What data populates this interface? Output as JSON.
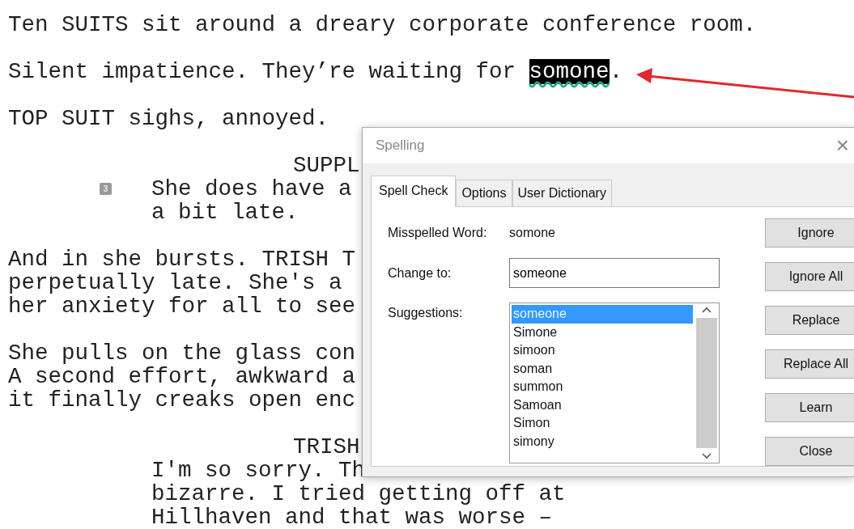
{
  "script": [
    {
      "kind": "action",
      "lines": [
        "Ten SUITS sit around a dreary corporate conference room."
      ]
    },
    {
      "kind": "flagged",
      "before": "Silent impatience. They’re waiting for ",
      "word": "somone",
      "after": "."
    },
    {
      "kind": "action",
      "lines": [
        "TOP SUIT sighs, annoyed."
      ]
    },
    {
      "kind": "character",
      "lines": [
        "SUPPL"
      ]
    },
    {
      "kind": "dialogue",
      "note_number": "3",
      "lines": [
        "She does have a",
        "a bit late."
      ]
    },
    {
      "kind": "action",
      "lines": [
        "And in she bursts. TRISH T",
        "perpetually late. She's a",
        "her anxiety for all to see"
      ]
    },
    {
      "kind": "action",
      "lines": [
        "She pulls on the glass con",
        "A second effort, awkward a",
        "it finally creaks open enc"
      ]
    },
    {
      "kind": "character",
      "lines": [
        "TRISH"
      ]
    },
    {
      "kind": "dialogue",
      "lines": [
        "I'm so sorry. Th",
        "bizarre. I tried getting off at",
        "Hillhaven and that was worse –"
      ]
    }
  ],
  "dialog": {
    "title": "Spelling",
    "close": "×",
    "tabs": [
      {
        "label": "Spell Check",
        "selected": true
      },
      {
        "label": "Options",
        "selected": false
      },
      {
        "label": "User Dictionary",
        "selected": false
      }
    ],
    "misspelled_label": "Misspelled Word:",
    "misspelled_value": "somone",
    "change_label": "Change to:",
    "change_value": "someone",
    "suggestions_label": "Suggestions:",
    "suggestions": [
      {
        "text": "someone",
        "selected": true
      },
      {
        "text": "Simone",
        "selected": false
      },
      {
        "text": "simoon",
        "selected": false
      },
      {
        "text": "soman",
        "selected": false
      },
      {
        "text": "summon",
        "selected": false
      },
      {
        "text": "Samoan",
        "selected": false
      },
      {
        "text": "Simon",
        "selected": false
      },
      {
        "text": "simony",
        "selected": false
      }
    ],
    "buttons": [
      "Ignore",
      "Ignore All",
      "Replace",
      "Replace All",
      "Learn",
      "Close"
    ]
  }
}
